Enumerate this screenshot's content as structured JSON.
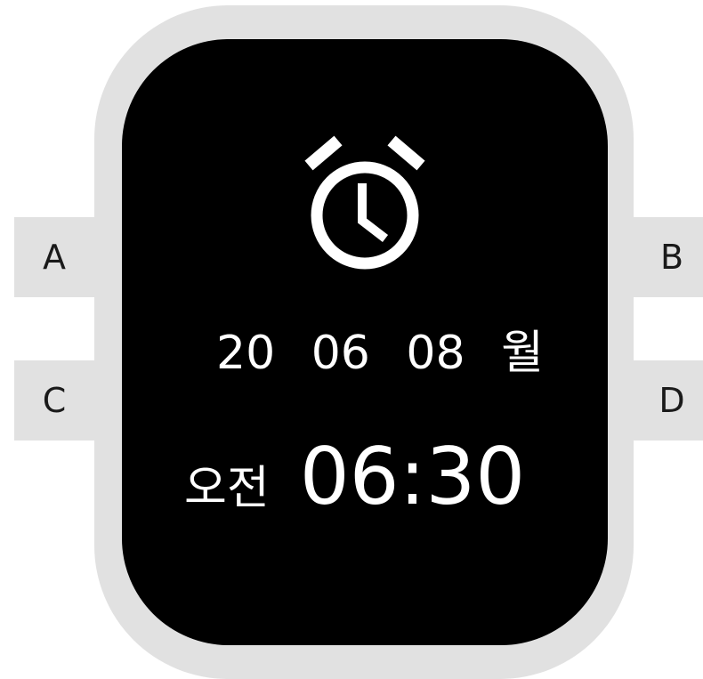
{
  "buttons": {
    "top_left": "A",
    "top_right": "B",
    "bottom_left": "C",
    "bottom_right": "D"
  },
  "screen": {
    "icon": "alarm-clock-icon",
    "date": {
      "year": "20",
      "month": "06",
      "day": "08",
      "weekday": "월"
    },
    "ampm": "오전",
    "time": "06:30"
  },
  "colors": {
    "frame": "#e1e1e1",
    "screen": "#000000",
    "text": "#ffffff"
  }
}
